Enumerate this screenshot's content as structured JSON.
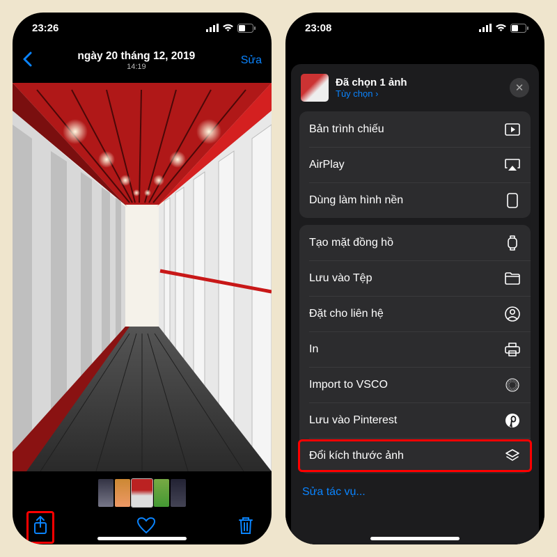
{
  "phoneA": {
    "status": {
      "time": "23:26"
    },
    "nav": {
      "date": "ngày 20 tháng 12, 2019",
      "time": "14:19",
      "edit": "Sửa"
    }
  },
  "phoneB": {
    "status": {
      "time": "23:08"
    },
    "sheet": {
      "title": "Đã chọn 1 ảnh",
      "options": "Tùy chọn",
      "group1": [
        {
          "label": "Bản trình chiếu",
          "icon": "play"
        },
        {
          "label": "AirPlay",
          "icon": "airplay"
        },
        {
          "label": "Dùng làm hình nền",
          "icon": "phone"
        }
      ],
      "group2": [
        {
          "label": "Tạo mặt đồng hồ",
          "icon": "watch"
        },
        {
          "label": "Lưu vào Tệp",
          "icon": "folder"
        },
        {
          "label": "Đặt cho liên hệ",
          "icon": "contact"
        },
        {
          "label": "In",
          "icon": "print"
        },
        {
          "label": "Import to VSCO",
          "icon": "circle"
        },
        {
          "label": "Lưu vào Pinterest",
          "icon": "pinterest"
        },
        {
          "label": "Đổi kích thước ảnh",
          "icon": "layers",
          "highlight": true
        }
      ],
      "editActions": "Sửa tác vụ..."
    }
  }
}
